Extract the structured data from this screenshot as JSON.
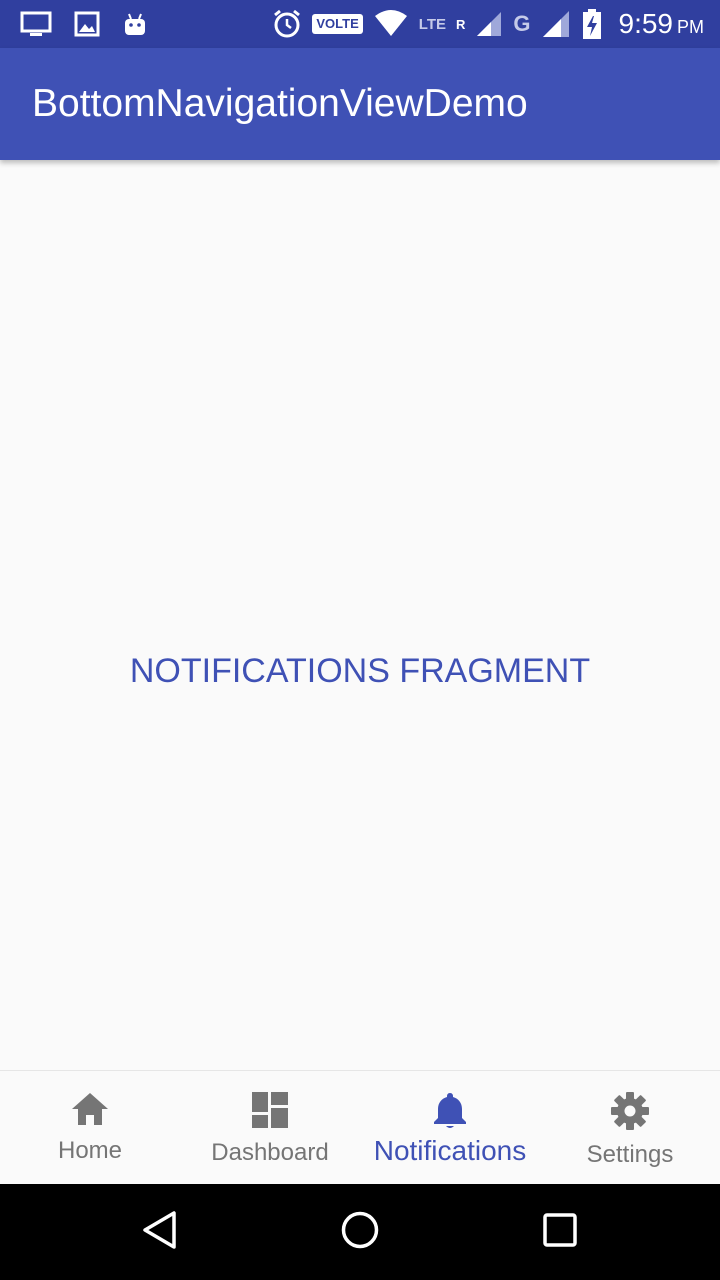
{
  "status_bar": {
    "volte_label": "VOLTE",
    "lte_label": "LTE",
    "roaming_label": "R",
    "g_label": "G",
    "time": "9:59",
    "ampm": "PM",
    "icons": [
      "monitor-icon",
      "image-icon",
      "android-icon",
      "alarm-icon",
      "wifi-icon",
      "signal-icon",
      "battery-charging-icon"
    ]
  },
  "app_bar": {
    "title": "BottomNavigationViewDemo"
  },
  "content": {
    "fragment_text": "NOTIFICATIONS FRAGMENT"
  },
  "bottom_nav": {
    "active": "Notifications",
    "accent_color": "#3f51b5",
    "items": [
      {
        "label": "Home",
        "icon": "home-icon"
      },
      {
        "label": "Dashboard",
        "icon": "dashboard-icon"
      },
      {
        "label": "Notifications",
        "icon": "bell-icon"
      },
      {
        "label": "Settings",
        "icon": "gear-icon"
      }
    ]
  },
  "system_nav": {
    "buttons": [
      "back-icon",
      "home-circle-icon",
      "recents-icon"
    ]
  }
}
